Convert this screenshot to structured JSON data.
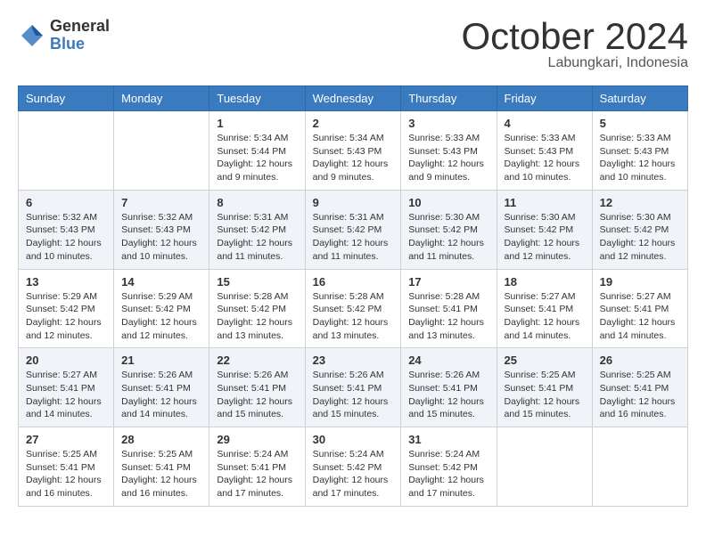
{
  "header": {
    "logo": {
      "general": "General",
      "blue": "Blue"
    },
    "title": "October 2024",
    "location": "Labungkari, Indonesia"
  },
  "calendar": {
    "days_of_week": [
      "Sunday",
      "Monday",
      "Tuesday",
      "Wednesday",
      "Thursday",
      "Friday",
      "Saturday"
    ],
    "weeks": [
      [
        {
          "day": "",
          "sunrise": "",
          "sunset": "",
          "daylight": ""
        },
        {
          "day": "",
          "sunrise": "",
          "sunset": "",
          "daylight": ""
        },
        {
          "day": "1",
          "sunrise": "Sunrise: 5:34 AM",
          "sunset": "Sunset: 5:44 PM",
          "daylight": "Daylight: 12 hours and 9 minutes."
        },
        {
          "day": "2",
          "sunrise": "Sunrise: 5:34 AM",
          "sunset": "Sunset: 5:43 PM",
          "daylight": "Daylight: 12 hours and 9 minutes."
        },
        {
          "day": "3",
          "sunrise": "Sunrise: 5:33 AM",
          "sunset": "Sunset: 5:43 PM",
          "daylight": "Daylight: 12 hours and 9 minutes."
        },
        {
          "day": "4",
          "sunrise": "Sunrise: 5:33 AM",
          "sunset": "Sunset: 5:43 PM",
          "daylight": "Daylight: 12 hours and 10 minutes."
        },
        {
          "day": "5",
          "sunrise": "Sunrise: 5:33 AM",
          "sunset": "Sunset: 5:43 PM",
          "daylight": "Daylight: 12 hours and 10 minutes."
        }
      ],
      [
        {
          "day": "6",
          "sunrise": "Sunrise: 5:32 AM",
          "sunset": "Sunset: 5:43 PM",
          "daylight": "Daylight: 12 hours and 10 minutes."
        },
        {
          "day": "7",
          "sunrise": "Sunrise: 5:32 AM",
          "sunset": "Sunset: 5:43 PM",
          "daylight": "Daylight: 12 hours and 10 minutes."
        },
        {
          "day": "8",
          "sunrise": "Sunrise: 5:31 AM",
          "sunset": "Sunset: 5:42 PM",
          "daylight": "Daylight: 12 hours and 11 minutes."
        },
        {
          "day": "9",
          "sunrise": "Sunrise: 5:31 AM",
          "sunset": "Sunset: 5:42 PM",
          "daylight": "Daylight: 12 hours and 11 minutes."
        },
        {
          "day": "10",
          "sunrise": "Sunrise: 5:30 AM",
          "sunset": "Sunset: 5:42 PM",
          "daylight": "Daylight: 12 hours and 11 minutes."
        },
        {
          "day": "11",
          "sunrise": "Sunrise: 5:30 AM",
          "sunset": "Sunset: 5:42 PM",
          "daylight": "Daylight: 12 hours and 12 minutes."
        },
        {
          "day": "12",
          "sunrise": "Sunrise: 5:30 AM",
          "sunset": "Sunset: 5:42 PM",
          "daylight": "Daylight: 12 hours and 12 minutes."
        }
      ],
      [
        {
          "day": "13",
          "sunrise": "Sunrise: 5:29 AM",
          "sunset": "Sunset: 5:42 PM",
          "daylight": "Daylight: 12 hours and 12 minutes."
        },
        {
          "day": "14",
          "sunrise": "Sunrise: 5:29 AM",
          "sunset": "Sunset: 5:42 PM",
          "daylight": "Daylight: 12 hours and 12 minutes."
        },
        {
          "day": "15",
          "sunrise": "Sunrise: 5:28 AM",
          "sunset": "Sunset: 5:42 PM",
          "daylight": "Daylight: 12 hours and 13 minutes."
        },
        {
          "day": "16",
          "sunrise": "Sunrise: 5:28 AM",
          "sunset": "Sunset: 5:42 PM",
          "daylight": "Daylight: 12 hours and 13 minutes."
        },
        {
          "day": "17",
          "sunrise": "Sunrise: 5:28 AM",
          "sunset": "Sunset: 5:41 PM",
          "daylight": "Daylight: 12 hours and 13 minutes."
        },
        {
          "day": "18",
          "sunrise": "Sunrise: 5:27 AM",
          "sunset": "Sunset: 5:41 PM",
          "daylight": "Daylight: 12 hours and 14 minutes."
        },
        {
          "day": "19",
          "sunrise": "Sunrise: 5:27 AM",
          "sunset": "Sunset: 5:41 PM",
          "daylight": "Daylight: 12 hours and 14 minutes."
        }
      ],
      [
        {
          "day": "20",
          "sunrise": "Sunrise: 5:27 AM",
          "sunset": "Sunset: 5:41 PM",
          "daylight": "Daylight: 12 hours and 14 minutes."
        },
        {
          "day": "21",
          "sunrise": "Sunrise: 5:26 AM",
          "sunset": "Sunset: 5:41 PM",
          "daylight": "Daylight: 12 hours and 14 minutes."
        },
        {
          "day": "22",
          "sunrise": "Sunrise: 5:26 AM",
          "sunset": "Sunset: 5:41 PM",
          "daylight": "Daylight: 12 hours and 15 minutes."
        },
        {
          "day": "23",
          "sunrise": "Sunrise: 5:26 AM",
          "sunset": "Sunset: 5:41 PM",
          "daylight": "Daylight: 12 hours and 15 minutes."
        },
        {
          "day": "24",
          "sunrise": "Sunrise: 5:26 AM",
          "sunset": "Sunset: 5:41 PM",
          "daylight": "Daylight: 12 hours and 15 minutes."
        },
        {
          "day": "25",
          "sunrise": "Sunrise: 5:25 AM",
          "sunset": "Sunset: 5:41 PM",
          "daylight": "Daylight: 12 hours and 15 minutes."
        },
        {
          "day": "26",
          "sunrise": "Sunrise: 5:25 AM",
          "sunset": "Sunset: 5:41 PM",
          "daylight": "Daylight: 12 hours and 16 minutes."
        }
      ],
      [
        {
          "day": "27",
          "sunrise": "Sunrise: 5:25 AM",
          "sunset": "Sunset: 5:41 PM",
          "daylight": "Daylight: 12 hours and 16 minutes."
        },
        {
          "day": "28",
          "sunrise": "Sunrise: 5:25 AM",
          "sunset": "Sunset: 5:41 PM",
          "daylight": "Daylight: 12 hours and 16 minutes."
        },
        {
          "day": "29",
          "sunrise": "Sunrise: 5:24 AM",
          "sunset": "Sunset: 5:41 PM",
          "daylight": "Daylight: 12 hours and 17 minutes."
        },
        {
          "day": "30",
          "sunrise": "Sunrise: 5:24 AM",
          "sunset": "Sunset: 5:42 PM",
          "daylight": "Daylight: 12 hours and 17 minutes."
        },
        {
          "day": "31",
          "sunrise": "Sunrise: 5:24 AM",
          "sunset": "Sunset: 5:42 PM",
          "daylight": "Daylight: 12 hours and 17 minutes."
        },
        {
          "day": "",
          "sunrise": "",
          "sunset": "",
          "daylight": ""
        },
        {
          "day": "",
          "sunrise": "",
          "sunset": "",
          "daylight": ""
        }
      ]
    ]
  }
}
